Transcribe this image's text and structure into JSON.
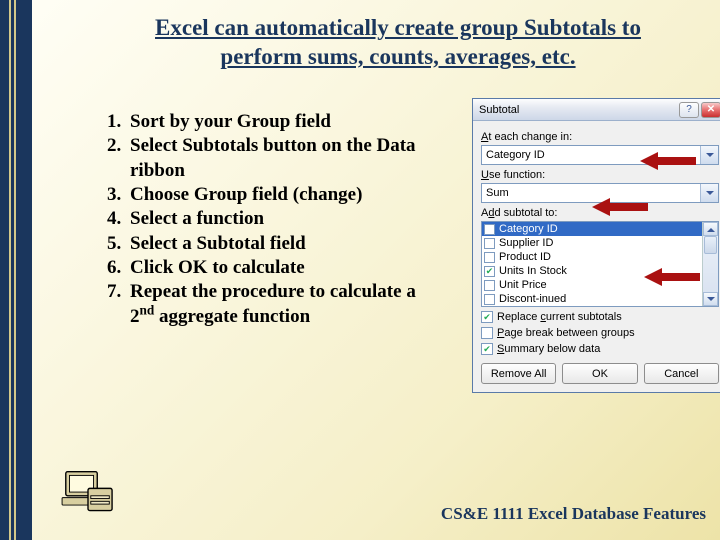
{
  "title_line1": "Excel can automatically create group Subtotals to",
  "title_line2": "perform sums, counts, averages, etc.",
  "steps": [
    "Sort by your Group field",
    "Select Subtotals button on the Data ribbon",
    "Choose Group field (change)",
    "Select a function",
    "Select a Subtotal field",
    "Click OK to calculate",
    "Repeat the procedure to calculate a 2"
  ],
  "step7_sup": "nd",
  "step7_tail": " aggregate function",
  "footer": "CS&E 1111 Excel Database Features",
  "dialog": {
    "title": "Subtotal",
    "lbl_change": "At each change in:",
    "combo_change": "Category ID",
    "lbl_func": "Use function:",
    "combo_func": "Sum",
    "lbl_add": "Add subtotal to:",
    "items": [
      {
        "label": "Category ID",
        "checked": false,
        "selected": true
      },
      {
        "label": "Supplier ID",
        "checked": false
      },
      {
        "label": "Product ID",
        "checked": false
      },
      {
        "label": "Units In Stock",
        "checked": true
      },
      {
        "label": "Unit Price",
        "checked": false
      },
      {
        "label": "Discont-inued",
        "checked": false
      }
    ],
    "chk_replace": "Replace current subtotals",
    "chk_pagebreak": "Page break between groups",
    "chk_summary": "Summary below data",
    "btn_removeall": "Remove All",
    "btn_ok": "OK",
    "btn_cancel": "Cancel"
  }
}
